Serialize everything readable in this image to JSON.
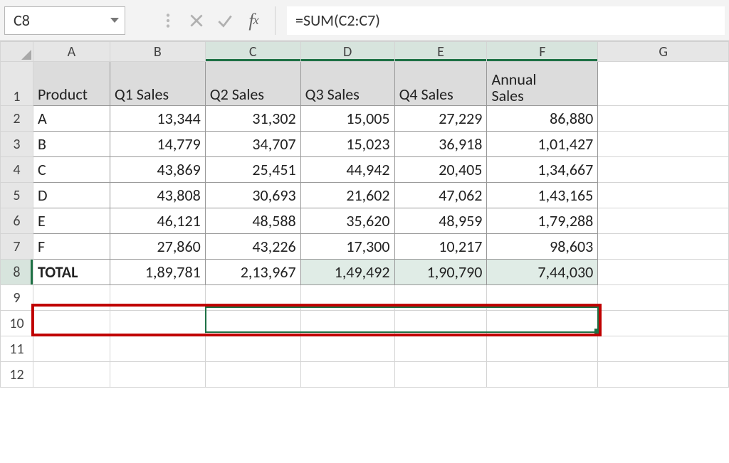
{
  "name_box": "C8",
  "formula": "=SUM(C2:C7)",
  "col_headers": [
    "A",
    "B",
    "C",
    "D",
    "E",
    "F",
    "G"
  ],
  "row_headers": [
    "1",
    "2",
    "3",
    "4",
    "5",
    "6",
    "7",
    "8",
    "9",
    "10",
    "11",
    "12"
  ],
  "header_row": {
    "A": "Product",
    "B": "Q1 Sales",
    "C": "Q2 Sales",
    "D": "Q3 Sales",
    "E": "Q4 Sales",
    "F_line1": "Annual",
    "F_line2": "Sales"
  },
  "rows": [
    {
      "p": "A",
      "q1": "13,344",
      "q2": "31,302",
      "q3": "15,005",
      "q4": "27,229",
      "ann": "86,880"
    },
    {
      "p": "B",
      "q1": "14,779",
      "q2": "34,707",
      "q3": "15,023",
      "q4": "36,918",
      "ann": "1,01,427"
    },
    {
      "p": "C",
      "q1": "43,869",
      "q2": "25,451",
      "q3": "44,942",
      "q4": "20,405",
      "ann": "1,34,667"
    },
    {
      "p": "D",
      "q1": "43,808",
      "q2": "30,693",
      "q3": "21,602",
      "q4": "47,062",
      "ann": "1,43,165"
    },
    {
      "p": "E",
      "q1": "46,121",
      "q2": "48,588",
      "q3": "35,620",
      "q4": "48,959",
      "ann": "1,79,288"
    },
    {
      "p": "F",
      "q1": "27,860",
      "q2": "43,226",
      "q3": "17,300",
      "q4": "10,217",
      "ann": "98,603"
    }
  ],
  "total": {
    "label": "TOTAL",
    "q1": "1,89,781",
    "q2": "2,13,967",
    "q3": "1,49,492",
    "q4": "1,90,790",
    "ann": "7,44,030"
  }
}
